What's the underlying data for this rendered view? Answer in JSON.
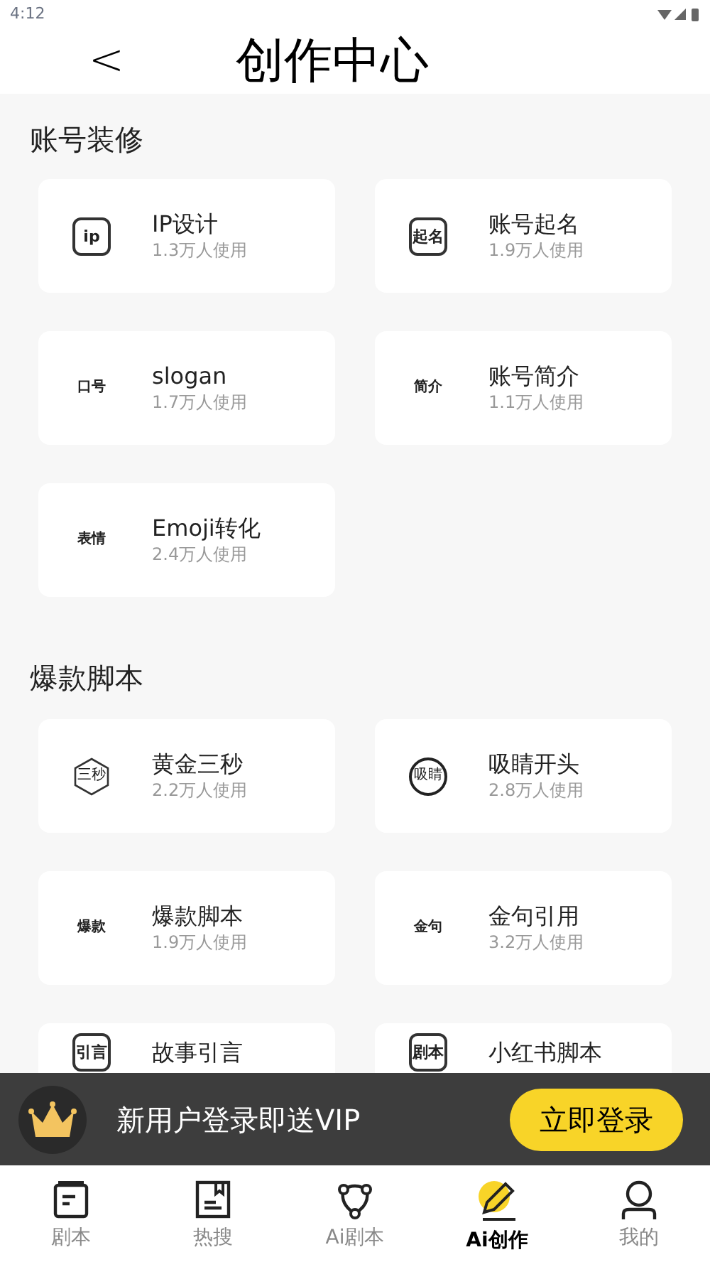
{
  "status_bar": {
    "time": "4:12"
  },
  "header": {
    "back": "<",
    "title": "创作中心"
  },
  "sections": [
    {
      "title": "账号装修",
      "items": [
        {
          "badge": "ip",
          "kind": "square",
          "title": "IP设计",
          "usage": "1.3万人使用"
        },
        {
          "badge": "起名",
          "kind": "square",
          "title": "账号起名",
          "usage": "1.9万人使用"
        },
        {
          "badge": "口号",
          "kind": "plain",
          "title": "slogan",
          "usage": "1.7万人使用"
        },
        {
          "badge": "简介",
          "kind": "plain",
          "title": "账号简介",
          "usage": "1.1万人使用"
        },
        {
          "badge": "表情",
          "kind": "plain",
          "title": "Emoji转化",
          "usage": "2.4万人使用"
        }
      ]
    },
    {
      "title": "爆款脚本",
      "items": [
        {
          "badge": "三秒",
          "kind": "hexagon",
          "title": "黄金三秒",
          "usage": "2.2万人使用"
        },
        {
          "badge": "吸睛",
          "kind": "circle",
          "title": "吸睛开头",
          "usage": "2.8万人使用"
        },
        {
          "badge": "爆款",
          "kind": "plain",
          "title": "爆款脚本",
          "usage": "1.9万人使用"
        },
        {
          "badge": "金句",
          "kind": "plain",
          "title": "金句引用",
          "usage": "3.2万人使用"
        },
        {
          "badge": "引言",
          "kind": "square",
          "title": "故事引言"
        },
        {
          "badge": "剧本",
          "kind": "square",
          "title": "小红书脚本"
        }
      ]
    }
  ],
  "promo_banner": {
    "text": "新用户登录即送VIP",
    "button": "立即登录"
  },
  "tab_bar": [
    {
      "label": "剧本",
      "selected": false
    },
    {
      "label": "热搜",
      "selected": false
    },
    {
      "label": "Ai剧本",
      "selected": false
    },
    {
      "label": "Ai创作",
      "selected": true
    },
    {
      "label": "我的",
      "selected": false
    }
  ]
}
